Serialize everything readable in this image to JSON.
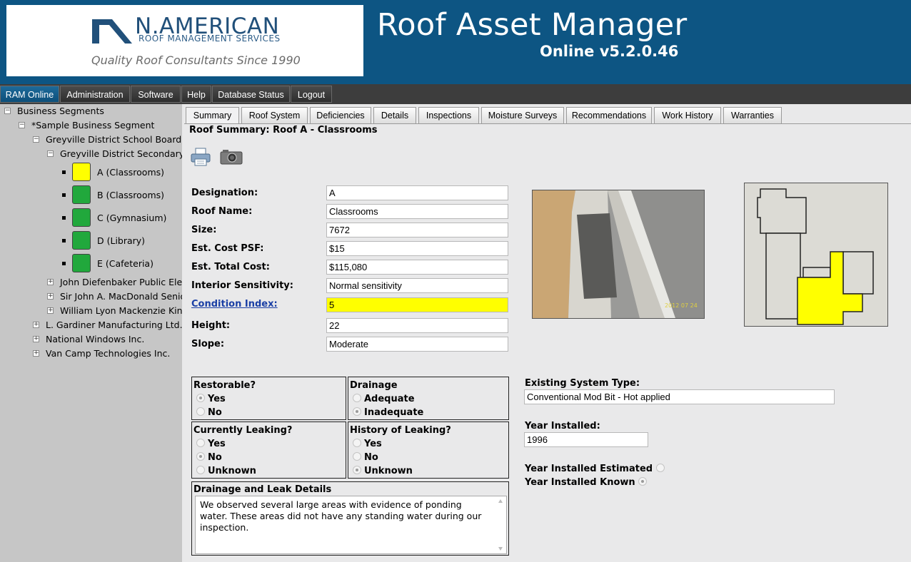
{
  "header": {
    "logo_name": "N.AMERICAN",
    "logo_sub": "ROOF MANAGEMENT SERVICES",
    "logo_tagline": "Quality Roof Consultants Since 1990",
    "app_title": "Roof Asset Manager",
    "app_version": "Online v5.2.0.46"
  },
  "menu": {
    "items": [
      "RAM Online",
      "Administration",
      "Software",
      "Help",
      "Database Status",
      "Logout"
    ],
    "active": "RAM Online"
  },
  "tree": {
    "root": "Business Segments",
    "segment": "*Sample Business Segment",
    "org": "Greyville District School Board",
    "school": "Greyville District Secondary S",
    "roofs": [
      {
        "label": "A (Classrooms)",
        "status_color": "#ffff00"
      },
      {
        "label": "B (Classrooms)",
        "status_color": "#21a83c"
      },
      {
        "label": "C (Gymnasium)",
        "status_color": "#21a83c"
      },
      {
        "label": "D (Library)",
        "status_color": "#21a83c"
      },
      {
        "label": "E (Cafeteria)",
        "status_color": "#21a83c"
      }
    ],
    "other_schools": [
      "John Diefenbaker Public Elem",
      "Sir John A. MacDonald Senior",
      "William Lyon Mackenzie King"
    ],
    "other_segments": [
      "L. Gardiner Manufacturing Ltd.",
      "National Windows Inc.",
      "Van Camp Technologies Inc."
    ]
  },
  "tabs": {
    "items": [
      "Summary",
      "Roof System",
      "Deficiencies",
      "Details",
      "Inspections",
      "Moisture Surveys",
      "Recommendations",
      "Work History",
      "Warranties"
    ],
    "active": "Summary"
  },
  "page_title": "Roof Summary: Roof A - Classrooms",
  "toolbar": {
    "print_icon": "printer-icon",
    "camera_icon": "camera-icon"
  },
  "form": {
    "designation": {
      "label": "Designation:",
      "value": "A"
    },
    "roof_name": {
      "label": "Roof Name:",
      "value": "Classrooms"
    },
    "size": {
      "label": "Size:",
      "value": "7672"
    },
    "cost_psf": {
      "label": "Est. Cost PSF:",
      "value": "$15"
    },
    "total_cost": {
      "label": "Est. Total Cost:",
      "value": "$115,080"
    },
    "interior_sensitivity": {
      "label": "Interior Sensitivity:",
      "value": "Normal sensitivity"
    },
    "condition_index": {
      "label": "Condition Index:",
      "value": "5",
      "highlight": "#ffff00"
    },
    "height": {
      "label": "Height:",
      "value": "22"
    },
    "slope": {
      "label": "Slope:",
      "value": "Moderate"
    }
  },
  "photo": {
    "date_stamp": "2012 07 24"
  },
  "options": {
    "restorable": {
      "title": "Restorable?",
      "options": [
        "Yes",
        "No"
      ],
      "selected": "Yes"
    },
    "drainage": {
      "title": "Drainage",
      "options": [
        "Adequate",
        "Inadequate"
      ],
      "selected": "Inadequate"
    },
    "currently_leaking": {
      "title": "Currently Leaking?",
      "options": [
        "Yes",
        "No",
        "Unknown"
      ],
      "selected": "No"
    },
    "history_leaking": {
      "title": "History of Leaking?",
      "options": [
        "Yes",
        "No",
        "Unknown"
      ],
      "selected": "Unknown"
    }
  },
  "details": {
    "title": "Drainage and Leak Details",
    "text": "We observed several large areas with evidence of ponding water. These areas did not have any standing water during our inspection."
  },
  "system": {
    "type_label": "Existing System Type:",
    "type_value": "Conventional Mod Bit - Hot applied",
    "year_label": "Year Installed:",
    "year_value": "1996",
    "estimated_label": "Year Installed Estimated",
    "known_label": "Year Installed Known",
    "year_mode": "known"
  }
}
